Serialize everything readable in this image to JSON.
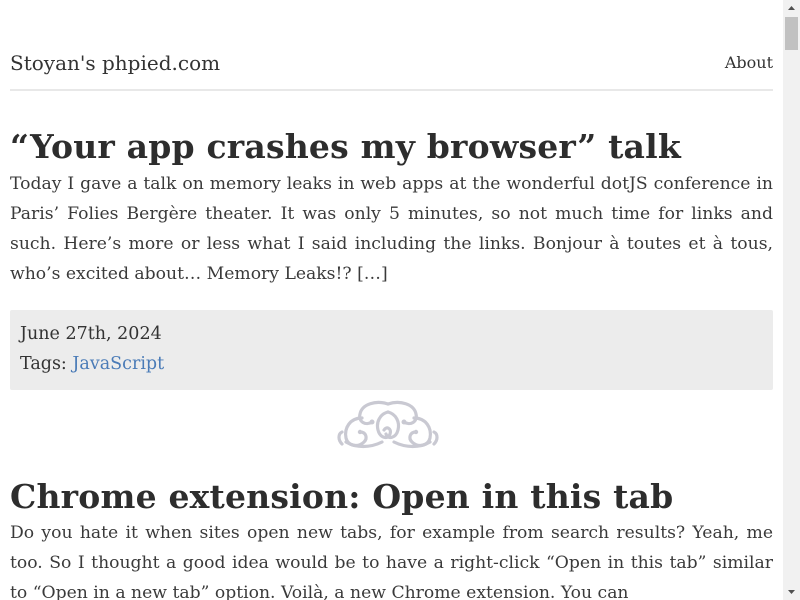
{
  "header": {
    "site_title": "Stoyan's phpied.com",
    "nav_about": "About"
  },
  "posts": [
    {
      "title": "“Your app crashes my browser” talk",
      "excerpt": "Today I gave a talk on memory leaks in web apps at the wonderful dotJS conference in Paris’ Folies Bergère theater. It was only 5 minutes, so not much time for links and such. Here’s more or less what I said including the links. Bonjour à toutes et à tous, who’s excited about… Memory Leaks!? […]",
      "date": "June 27th, 2024",
      "tags_label": "Tags:",
      "tags": [
        "JavaScript"
      ]
    },
    {
      "title": "Chrome extension: Open in this tab",
      "excerpt": "Do you hate it when sites open new tabs, for example from search results? Yeah, me too. So I thought a good idea would be to have a right-click “Open in this tab” similar to “Open in a new tab” option. Voilà, a new Chrome extension. You can"
    }
  ],
  "colors": {
    "link": "#4a7bb7",
    "meta_bg": "#ececec",
    "ornament": "#c9c9d2"
  },
  "icons": {
    "divider": "flourish-ornament-icon",
    "scroll_up": "scroll-up-arrow-icon",
    "scroll_down": "scroll-down-arrow-icon"
  }
}
